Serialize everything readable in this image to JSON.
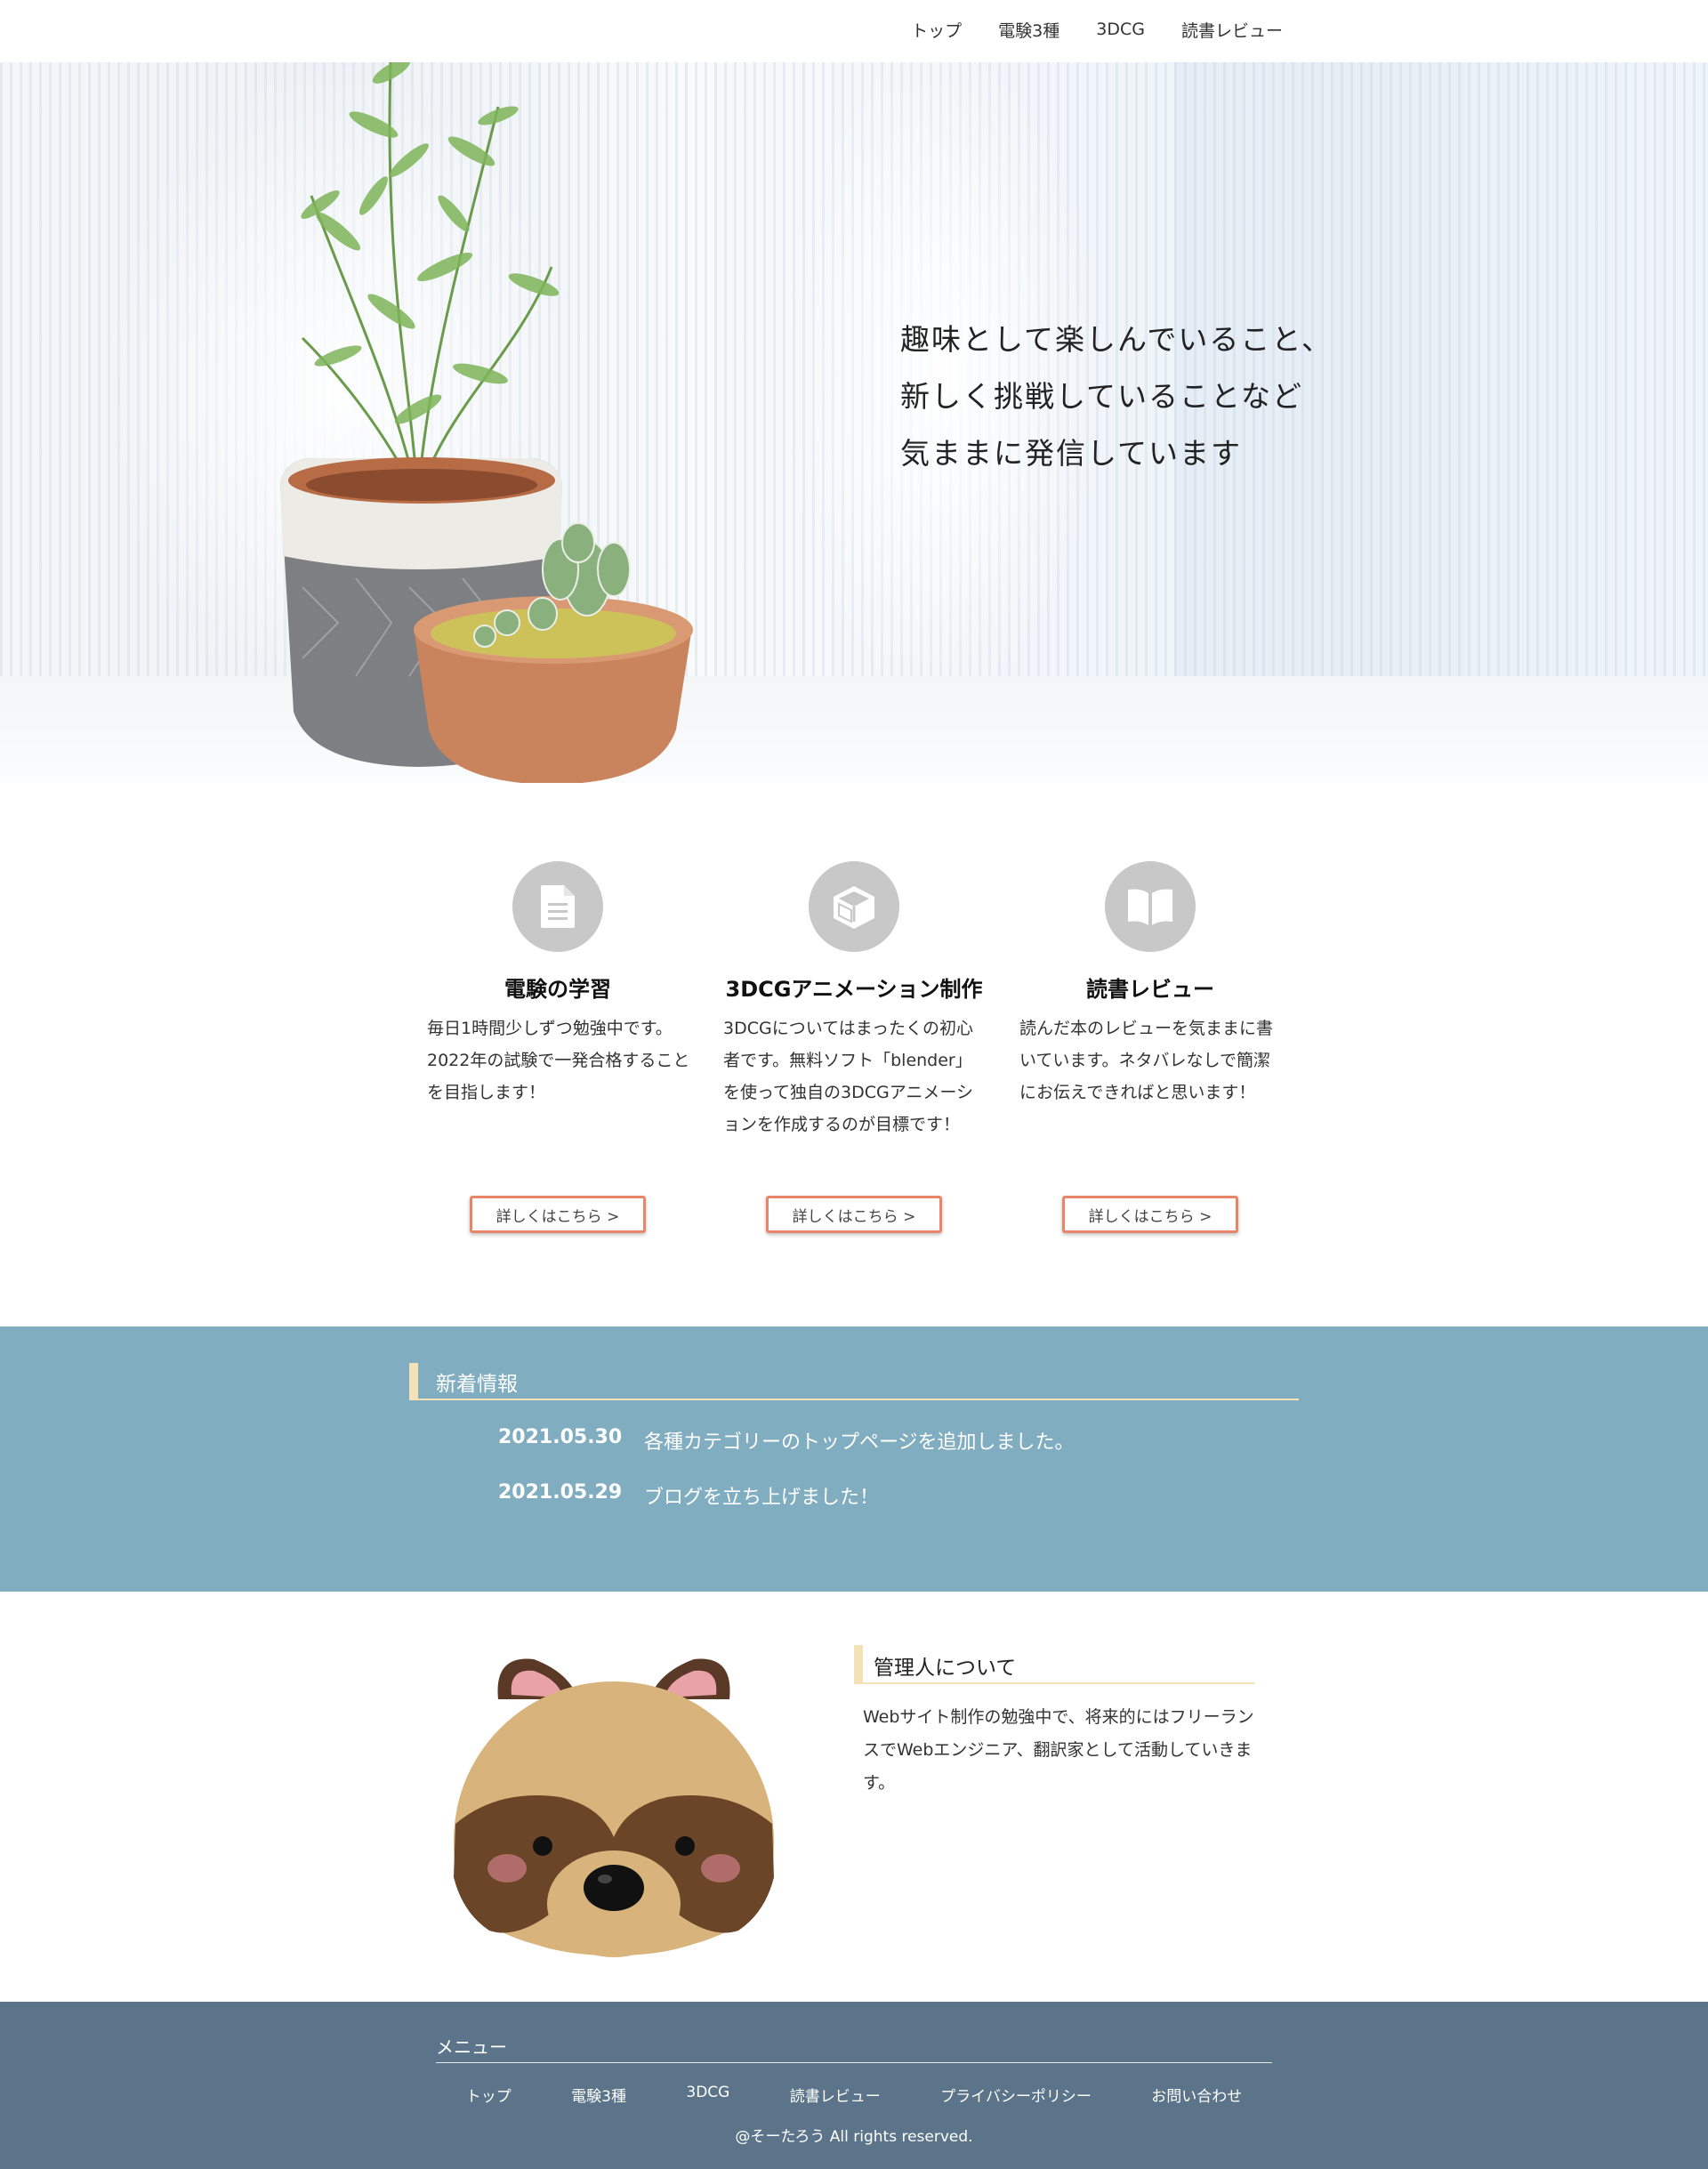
{
  "nav": {
    "items": [
      "トップ",
      "電験3種",
      "3DCG",
      "読書レビュー"
    ]
  },
  "hero": {
    "lines": [
      "趣味として楽しんでいること、",
      "新しく挑戦していることなど",
      "気ままに発信しています"
    ]
  },
  "features": [
    {
      "icon": "document-icon",
      "title": "電験の学習",
      "text": "毎日1時間少しずつ勉強中です。2022年の試験で一発合格することを目指します！",
      "button": "詳しくはこちら >"
    },
    {
      "icon": "cube-icon",
      "title": "3DCGアニメーション制作",
      "text": "3DCGについてはまったくの初心者です。無料ソフト「blender」を使って独自の3DCGアニメーションを作成するのが目標です！",
      "button": "詳しくはこちら >"
    },
    {
      "icon": "book-icon",
      "title": "読書レビュー",
      "text": "読んだ本のレビューを気ままに書いています。ネタバレなしで簡潔にお伝えできればと思います！",
      "button": "詳しくはこちら >"
    }
  ],
  "news": {
    "heading": "新着情報",
    "items": [
      {
        "date": "2021.05.30",
        "text": "各種カテゴリーのトップページを追加しました。"
      },
      {
        "date": "2021.05.29",
        "text": "ブログを立ち上げました！"
      }
    ]
  },
  "about": {
    "heading": "管理人について",
    "text": "Webサイト制作の勉強中で、将来的にはフリーランスでWebエンジニア、翻訳家として活動していきます。"
  },
  "footer": {
    "menu_title": "メニュー",
    "links": [
      "トップ",
      "電験3種",
      "3DCG",
      "読書レビュー",
      "プライバシーポリシー",
      "お問い合わせ"
    ],
    "copyright": "@そーたろう All rights reserved."
  },
  "colors": {
    "news_bg": "#81adc0",
    "footer_bg": "#5b7489",
    "accent_border": "#f3e2b5",
    "button_border": "#e8866a",
    "icon_circle": "#c8c8c8"
  }
}
